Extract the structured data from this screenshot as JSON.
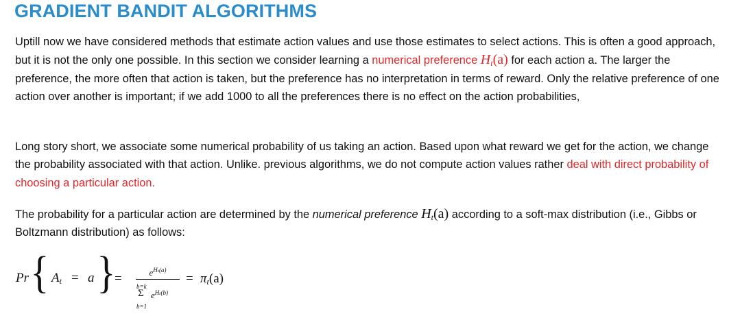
{
  "heading": "GRADIENT BANDIT ALGORITHMS",
  "paragraph1": {
    "before": "Uptill now we have considered methods that estimate action values and use those estimates to select actions. This is often a good approach, but it is not the only one possible. In this section we consider learning a ",
    "highlight": "numerical preference ",
    "math_H": "H",
    "math_sub": "t",
    "math_arg": "(a)",
    "after": " for each action a. The larger the preference, the more often that action is taken, but the preference has no interpretation in terms of reward. Only the relative preference of one action over another is important; if we add 1000 to all the preferences there is no effect on the action probabilities,"
  },
  "paragraph2": {
    "before": "Long story short, we associate some numerical probability of us taking an action. Based upon what reward we get for the action, we change the probability associated with that action. Unlike. previous algorithms, we do not compute action values rather ",
    "highlight": "deal with direct probability of choosing a particular action."
  },
  "paragraph3": {
    "before": "The probability for a particular action are determined by the ",
    "emphasis": "numerical preference ",
    "math_H": "H",
    "math_sub": "t",
    "math_arg": "(a)",
    "after": " according to a soft-max distribution (i.e., Gibbs or Boltzmann distribution) as follows:"
  },
  "equation": {
    "pr": "Pr",
    "brace_left": "{",
    "brace_right": "}",
    "A": "A",
    "A_sub": "t",
    "eq": "=",
    "a": "a",
    "numerator_base": "e",
    "numerator_exp": "Hₜ(a)",
    "sum_top": "b=k",
    "sigma": "Σ",
    "denominator_base": "e",
    "denominator_exp": "Hₜ(b)",
    "sum_bottom": "b=1",
    "pi": "π",
    "pi_sub": "t",
    "pi_arg": "(a)"
  },
  "colors": {
    "heading": "#2b8ccb",
    "highlight": "#e0282b",
    "text": "#111111"
  }
}
